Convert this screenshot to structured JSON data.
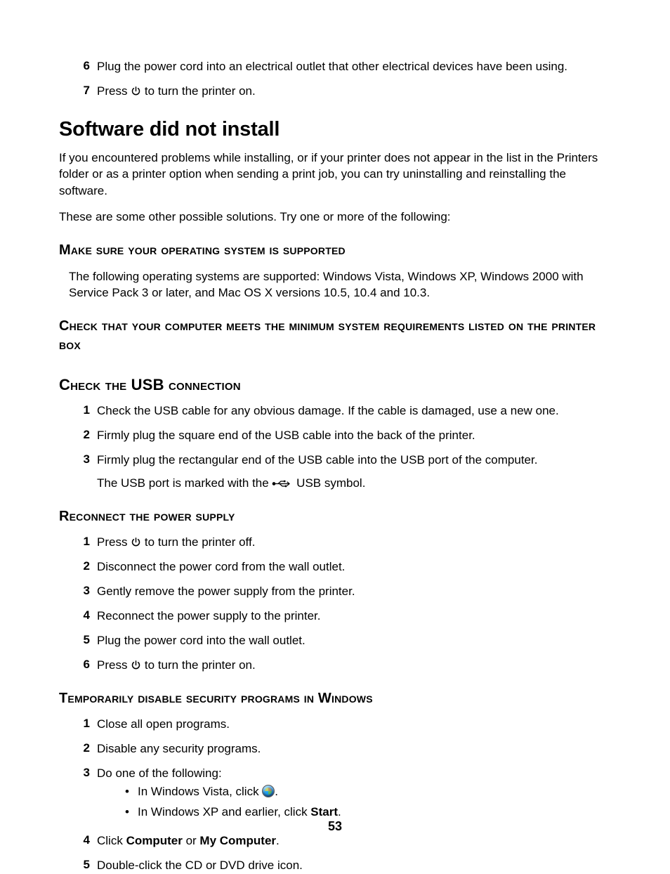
{
  "topSteps": [
    {
      "n": "6",
      "text": "Plug the power cord into an electrical outlet that other electrical devices have been using."
    },
    {
      "n": "7",
      "pre": "Press ",
      "icon": "power",
      "post": " to turn the printer on."
    }
  ],
  "section": {
    "title": "Software did not install",
    "para1": "If you encountered problems while installing, or if your printer does not appear in the list in the Printers folder or as a printer option when sending a print job, you can try uninstalling and reinstalling the software.",
    "para2": "These are some other possible solutions. Try one or more of the following:"
  },
  "sub1": {
    "title": "Make sure your operating system is supported",
    "text": "The following operating systems are supported: Windows Vista, Windows XP, Windows 2000 with Service Pack 3 or later, and Mac OS X versions 10.5, 10.4 and 10.3."
  },
  "sub2": {
    "title": "Check that your computer meets the minimum system requirements listed on the printer box"
  },
  "sub3": {
    "title": "Check the USB connection",
    "items": [
      {
        "n": "1",
        "text": "Check the USB cable for any obvious damage. If the cable is damaged, use a new one."
      },
      {
        "n": "2",
        "text": "Firmly plug the square end of the USB cable into the back of the printer."
      },
      {
        "n": "3",
        "text": "Firmly plug the rectangular end of the USB cable into the USB port of the computer.",
        "sub_pre": "The USB port is marked with the ",
        "sub_icon": "usb",
        "sub_post": " USB symbol."
      }
    ]
  },
  "sub4": {
    "title": "Reconnect the power supply",
    "items": [
      {
        "n": "1",
        "pre": "Press ",
        "icon": "power",
        "post": " to turn the printer off."
      },
      {
        "n": "2",
        "text": "Disconnect the power cord from the wall outlet."
      },
      {
        "n": "3",
        "text": "Gently remove the power supply from the printer."
      },
      {
        "n": "4",
        "text": "Reconnect the power supply to the printer."
      },
      {
        "n": "5",
        "text": "Plug the power cord into the wall outlet."
      },
      {
        "n": "6",
        "pre": "Press ",
        "icon": "power",
        "post": " to turn the printer on."
      }
    ]
  },
  "sub5": {
    "title": "Temporarily disable security programs in Windows",
    "items": [
      {
        "n": "1",
        "text": "Close all open programs."
      },
      {
        "n": "2",
        "text": "Disable any security programs."
      },
      {
        "n": "3",
        "text": "Do one of the following:",
        "bullets": [
          {
            "pre": "In Windows Vista, click ",
            "icon": "vista",
            "post": "."
          },
          {
            "pre": "In Windows XP and earlier, click ",
            "bold": "Start",
            "post": "."
          }
        ]
      },
      {
        "n": "4",
        "pre": "Click ",
        "bold": "Computer",
        "mid": " or ",
        "bold2": "My Computer",
        "post": "."
      },
      {
        "n": "5",
        "text": "Double-click the CD or DVD drive icon."
      }
    ]
  },
  "pageNumber": "53"
}
